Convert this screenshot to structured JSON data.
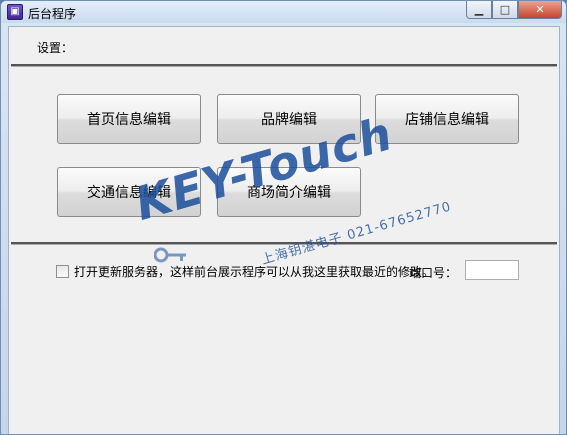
{
  "window": {
    "title": "后台程序",
    "icon": "app-icon"
  },
  "caption": {
    "minimize": "▁",
    "maximize": "□",
    "close": "✕"
  },
  "settings_label": "设置：",
  "buttons": [
    {
      "label": "首页信息编辑"
    },
    {
      "label": "品牌编辑"
    },
    {
      "label": "店铺信息编辑"
    },
    {
      "label": "交通信息编辑"
    },
    {
      "label": "商场简介编辑"
    }
  ],
  "update_server": {
    "checked": false,
    "label": "打开更新服务器，这样前台展示程序可以从我这里获取最近的修改。"
  },
  "port": {
    "label": "端口号：",
    "value": ""
  },
  "watermark": {
    "brand": "KEY-Touch",
    "sub": "上海钥湛电子 021-67652770"
  }
}
